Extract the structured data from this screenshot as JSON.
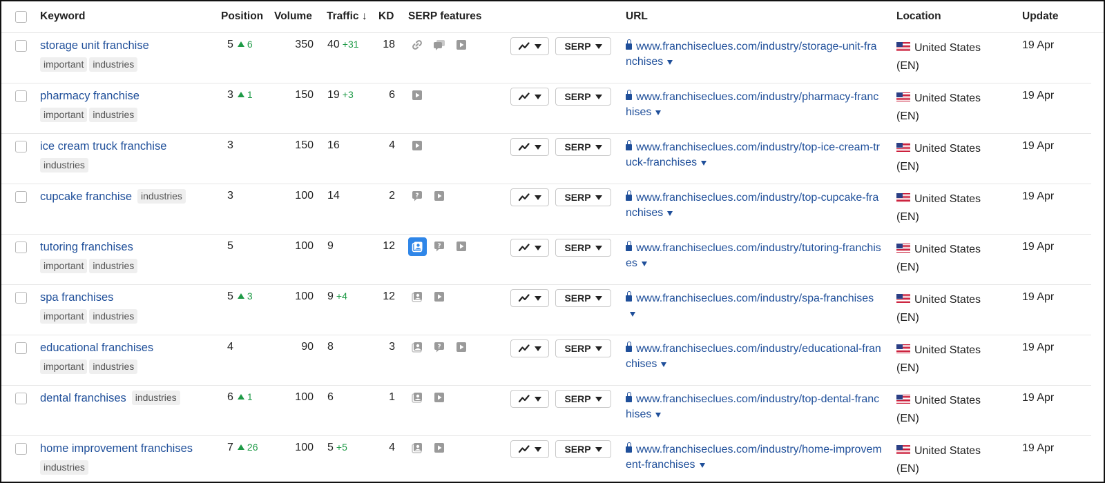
{
  "columns": {
    "keyword": "Keyword",
    "position": "Position",
    "volume": "Volume",
    "traffic": "Traffic ↓",
    "kd": "KD",
    "serp_features": "SERP features",
    "url": "URL",
    "location": "Location",
    "update": "Update"
  },
  "buttons": {
    "serp_label": "SERP"
  },
  "colors": {
    "link": "#1f4f9a",
    "positive": "#1e9a46",
    "highlight": "#2f86e8"
  },
  "rows": [
    {
      "keyword": "storage unit franchise",
      "tags": [
        "important",
        "industries"
      ],
      "tags_inline": false,
      "position": "5",
      "change": "6",
      "volume": "350",
      "traffic": "40",
      "traffic_delta": "+31",
      "kd": "18",
      "features": [
        "link-icon",
        "reviews-icon",
        "video-icon"
      ],
      "highlight": "",
      "url": "www.franchiseclues.com/industry/storage-unit-franchises",
      "location": "United States",
      "lang": "(EN)",
      "update": "19 Apr"
    },
    {
      "keyword": "pharmacy franchise",
      "tags": [
        "important",
        "industries"
      ],
      "tags_inline": false,
      "position": "3",
      "change": "1",
      "volume": "150",
      "traffic": "19",
      "traffic_delta": "+3",
      "kd": "6",
      "features": [
        "video-icon"
      ],
      "highlight": "",
      "url": "www.franchiseclues.com/industry/pharmacy-franchises",
      "location": "United States",
      "lang": "(EN)",
      "update": "19 Apr"
    },
    {
      "keyword": "ice cream truck franchise",
      "tags": [
        "industries"
      ],
      "tags_inline": false,
      "position": "3",
      "change": "",
      "volume": "150",
      "traffic": "16",
      "traffic_delta": "",
      "kd": "4",
      "features": [
        "video-icon"
      ],
      "highlight": "",
      "url": "www.franchiseclues.com/industry/top-ice-cream-truck-franchises",
      "location": "United States",
      "lang": "(EN)",
      "update": "19 Apr"
    },
    {
      "keyword": "cupcake franchise",
      "tags": [
        "industries"
      ],
      "tags_inline": true,
      "position": "3",
      "change": "",
      "volume": "100",
      "traffic": "14",
      "traffic_delta": "",
      "kd": "2",
      "features": [
        "faq-icon",
        "video-icon"
      ],
      "highlight": "",
      "url": "www.franchiseclues.com/industry/top-cupcake-franchises",
      "location": "United States",
      "lang": "(EN)",
      "update": "19 Apr"
    },
    {
      "keyword": "tutoring franchises",
      "tags": [
        "important",
        "industries"
      ],
      "tags_inline": false,
      "position": "5",
      "change": "",
      "volume": "100",
      "traffic": "9",
      "traffic_delta": "",
      "kd": "12",
      "features": [
        "image-icon",
        "faq-icon",
        "video-icon"
      ],
      "highlight": "image-icon",
      "url": "www.franchiseclues.com/industry/tutoring-franchises",
      "location": "United States",
      "lang": "(EN)",
      "update": "19 Apr"
    },
    {
      "keyword": "spa franchises",
      "tags": [
        "important",
        "industries"
      ],
      "tags_inline": false,
      "position": "5",
      "change": "3",
      "volume": "100",
      "traffic": "9",
      "traffic_delta": "+4",
      "kd": "12",
      "features": [
        "image-icon",
        "video-icon"
      ],
      "highlight": "",
      "url": "www.franchiseclues.com/industry/spa-franchises",
      "location": "United States",
      "lang": "(EN)",
      "update": "19 Apr"
    },
    {
      "keyword": "educational franchises",
      "tags": [
        "important",
        "industries"
      ],
      "tags_inline": false,
      "position": "4",
      "change": "",
      "volume": "90",
      "traffic": "8",
      "traffic_delta": "",
      "kd": "3",
      "features": [
        "image-icon",
        "faq-icon",
        "video-icon"
      ],
      "highlight": "",
      "url": "www.franchiseclues.com/industry/educational-franchises",
      "location": "United States",
      "lang": "(EN)",
      "update": "19 Apr"
    },
    {
      "keyword": "dental franchises",
      "tags": [
        "industries"
      ],
      "tags_inline": true,
      "position": "6",
      "change": "1",
      "volume": "100",
      "traffic": "6",
      "traffic_delta": "",
      "kd": "1",
      "features": [
        "image-icon",
        "video-icon"
      ],
      "highlight": "",
      "url": "www.franchiseclues.com/industry/top-dental-franchises",
      "location": "United States",
      "lang": "(EN)",
      "update": "19 Apr"
    },
    {
      "keyword": "home improvement franchises",
      "tags": [
        "industries"
      ],
      "tags_inline": false,
      "position": "7",
      "change": "26",
      "volume": "100",
      "traffic": "5",
      "traffic_delta": "+5",
      "kd": "4",
      "features": [
        "image-icon",
        "video-icon"
      ],
      "highlight": "",
      "url": "www.franchiseclues.com/industry/home-improvement-franchises",
      "location": "United States",
      "lang": "(EN)",
      "update": "19 Apr"
    }
  ]
}
